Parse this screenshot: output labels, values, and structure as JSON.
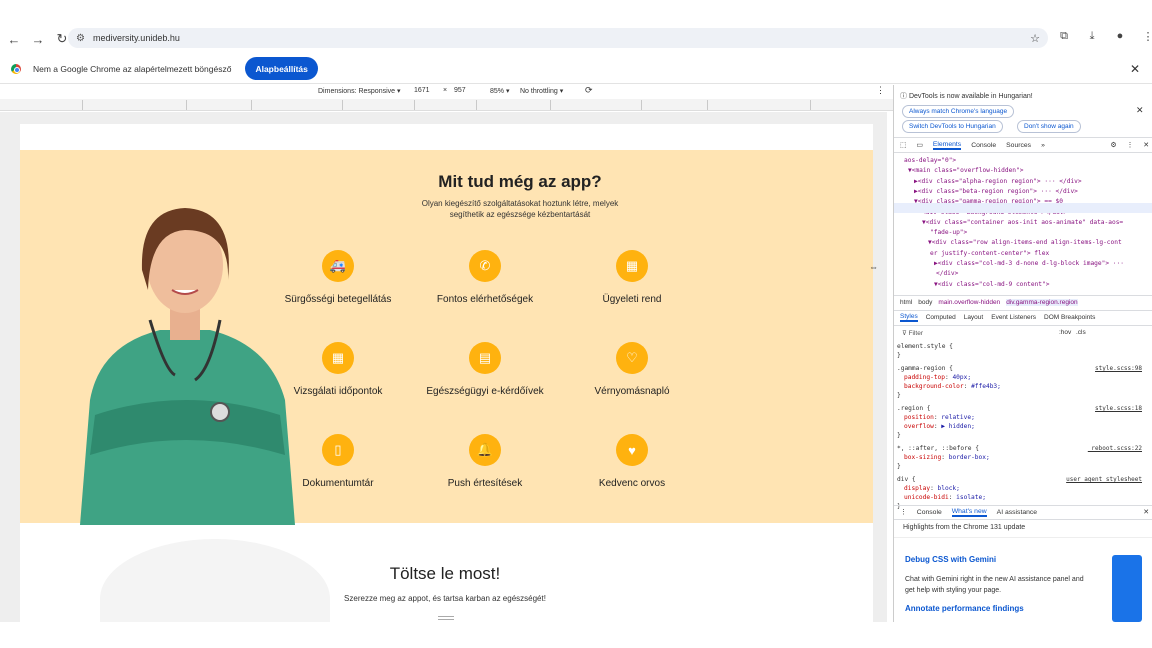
{
  "browser": {
    "url": "mediversity.unideb.hu"
  },
  "infobar": {
    "message": "Nem a Google Chrome az alapértelmezett böngésző",
    "button": "Alapbeállítás"
  },
  "device_toolbar": {
    "dimensions": "Dimensions: Responsive",
    "width": "1671",
    "times": "×",
    "height": "957",
    "zoom": "85%",
    "throttling": "No throttling"
  },
  "hero": {
    "title": "Mit tud még az app?",
    "subtitle": "Olyan kiegészítő szolgáltatásokat hoztunk létre, melyek segíthetik az egészsége kézbentartását",
    "features": [
      {
        "label": "Sürgősségi betegellátás",
        "icon": "ambulance-icon"
      },
      {
        "label": "Fontos elérhetőségek",
        "icon": "phone-icon"
      },
      {
        "label": "Ügyeleti rend",
        "icon": "calendar-icon"
      },
      {
        "label": "Vizsgálati időpontok",
        "icon": "calendar-icon"
      },
      {
        "label": "Egészségügyi e-kérdőívek",
        "icon": "clipboard-icon"
      },
      {
        "label": "Vérnyomásnapló",
        "icon": "heart-pulse-icon"
      },
      {
        "label": "Dokumentumtár",
        "icon": "document-icon"
      },
      {
        "label": "Push értesítések",
        "icon": "bell-icon"
      },
      {
        "label": "Kedvenc orvos",
        "icon": "heart-icon"
      }
    ]
  },
  "cta": {
    "title": "Töltse le most!",
    "subtitle": "Szerezze meg az appot, és tartsa karban az egészségét!"
  },
  "devtools": {
    "notice": "DevTools is now available in Hungarian!",
    "btn_match": "Always match Chrome's language",
    "btn_switch": "Switch DevTools to Hungarian",
    "btn_dont": "Don't show again",
    "tabs": [
      "Elements",
      "Console",
      "Sources"
    ],
    "dom": [
      "aos-delay=\"0\">",
      "▼<main class=\"overflow-hidden\">",
      "▶<div class=\"alpha-region region\"> ··· </div>",
      "▶<div class=\"beta-region region\"> ··· </div>",
      "▼<div class=\"gamma-region region\"> == $0",
      "<div class=\"background-elements\"></div>",
      "▼<div class=\"container aos-init aos-animate\" data-aos=",
      "\"fade-up\">",
      "▼<div class=\"row align-items-end align-items-lg-cont",
      "er justify-content-center\"> flex",
      "▶<div class=\"col-md-3 d-none d-lg-block image\"> ···",
      "</div>",
      "▼<div class=\"col-md-9 content\">"
    ],
    "breadcrumb": [
      "html",
      "body",
      "main.overflow-hidden",
      "div.gamma-region.region"
    ],
    "style_tabs": [
      "Styles",
      "Computed",
      "Layout",
      "Event Listeners",
      "DOM Breakpoints"
    ],
    "filter_placeholder": "Filter",
    "hov": ":hov",
    ".cls": ".cls",
    "rules": [
      {
        "sel": "element.style {",
        "decls": [],
        "src": ""
      },
      {
        "sel": ".gamma-region {",
        "decls": [
          [
            "padding-top",
            "40px;"
          ],
          [
            "background-color",
            "#ffe4b3;"
          ]
        ],
        "src": "style.scss:98"
      },
      {
        "sel": ".region {",
        "decls": [
          [
            "position",
            "relative;"
          ],
          [
            "overflow",
            "▶ hidden;"
          ]
        ],
        "src": "style.scss:18"
      },
      {
        "sel": "*, ::after, ::before {",
        "decls": [
          [
            "box-sizing",
            "border-box;"
          ]
        ],
        "src": "_reboot.scss:22"
      },
      {
        "sel": "div {",
        "decls": [
          [
            "display",
            "block;"
          ],
          [
            "unicode-bidi",
            "isolate;"
          ]
        ],
        "src": "user agent stylesheet"
      }
    ],
    "drawer_tabs": [
      "Console",
      "What's new",
      "AI assistance"
    ],
    "whatsnew": {
      "highlights": "Highlights from the Chrome 131 update",
      "h1": "Debug CSS with Gemini",
      "p1": "Chat with Gemini right in the new AI assistance panel and get help with styling your page.",
      "h2": "Annotate performance findings"
    }
  },
  "colors": {
    "accent": "#ffb20f",
    "hero_bg": "#ffe4b3",
    "chrome_blue": "#0b57d0"
  }
}
